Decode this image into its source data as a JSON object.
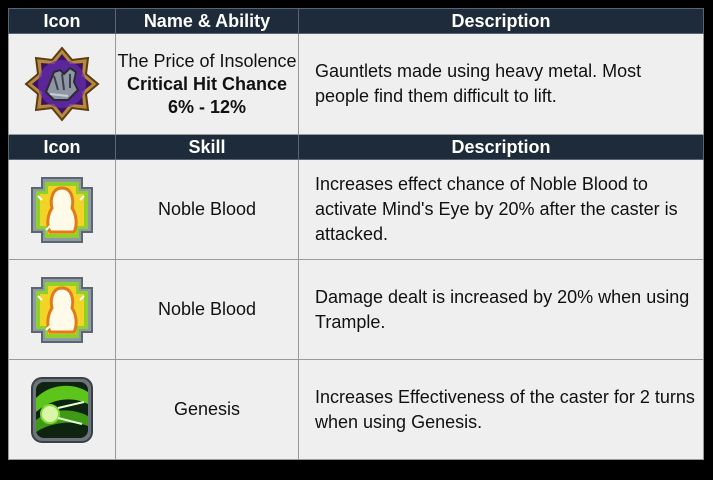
{
  "equipment_header": {
    "icon": "Icon",
    "name": "Name & Ability",
    "description": "Description"
  },
  "equipment": {
    "icon": "gauntlet-icon",
    "name": "The Price of Insolence",
    "ability_label": "Critical Hit Chance",
    "ability_value": "6% - 12%",
    "description": "Gauntlets made using heavy metal. Most people find them difficult to lift."
  },
  "skill_header": {
    "icon": "Icon",
    "skill": "Skill",
    "description": "Description"
  },
  "skills": [
    {
      "icon": "noble-blood-icon",
      "name": "Noble Blood",
      "description": "Increases effect chance of Noble Blood to activate Mind's Eye by 20% after the caster is attacked."
    },
    {
      "icon": "noble-blood-icon",
      "name": "Noble Blood",
      "description": "Damage dealt is increased by 20% when using Trample."
    },
    {
      "icon": "genesis-icon",
      "name": "Genesis",
      "description": "Increases Effectiveness of the caster for 2 turns when using Genesis."
    }
  ]
}
